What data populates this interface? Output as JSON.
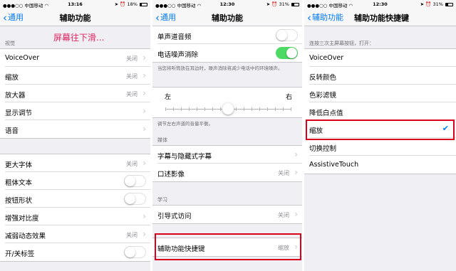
{
  "status": {
    "carrier": "中国移动",
    "time_1": "13:16",
    "battery_1": "18%",
    "battery_1_level": 0.18,
    "time_2": "12:30",
    "battery_2": "31%",
    "battery_2_level": 0.31,
    "time_3": "12:30",
    "battery_3": "31%",
    "battery_3_level": 0.31
  },
  "screen1": {
    "back_label": "通用",
    "title": "辅助功能",
    "section_vision": "视觉",
    "annotation": "屏幕往下滑...",
    "rows_a": [
      {
        "label": "VoiceOver",
        "value": "关闭"
      },
      {
        "label": "缩放",
        "value": "关闭"
      },
      {
        "label": "放大器",
        "value": "关闭"
      },
      {
        "label": "显示调节",
        "value": ""
      },
      {
        "label": "语音",
        "value": ""
      }
    ],
    "rows_b": [
      {
        "label": "更大字体",
        "value": "关闭"
      },
      {
        "label": "粗体文本",
        "value": ""
      },
      {
        "label": "按钮形状",
        "value": ""
      },
      {
        "label": "增强对比度",
        "value": ""
      },
      {
        "label": "减弱动态效果",
        "value": "关闭"
      },
      {
        "label": "开/关标签",
        "value": ""
      }
    ]
  },
  "screen2": {
    "back_label": "通用",
    "title": "辅助功能",
    "mono_audio": "单声道音频",
    "noise_cancel": "电话噪声消除",
    "noise_note": "当您将听筒放在耳边时，噪声消除将减少电话中的环境噪声。",
    "balance_left": "左",
    "balance_right": "右",
    "balance_value": 0.5,
    "balance_note": "调节左右声道的音量平衡。",
    "section_media": "媒体",
    "subtitles": "字幕与隐藏式字幕",
    "audio_desc": "口述影像",
    "audio_desc_value": "关闭",
    "section_learning": "学习",
    "guided_access": "引导式访问",
    "guided_access_value": "关闭",
    "shortcut": "辅助功能快捷键",
    "shortcut_value": "缩放"
  },
  "screen3": {
    "back_label": "辅助功能",
    "title": "辅助功能快捷键",
    "header": "连按三次主屏幕按钮，打开：",
    "options": [
      {
        "label": "VoiceOver",
        "selected": false
      },
      {
        "label": "反转颜色",
        "selected": false
      },
      {
        "label": "色彩滤镜",
        "selected": false
      },
      {
        "label": "降低白点值",
        "selected": false
      },
      {
        "label": "缩放",
        "selected": true
      },
      {
        "label": "切换控制",
        "selected": false
      },
      {
        "label": "AssistiveTouch",
        "selected": false
      }
    ]
  },
  "colors": {
    "accent": "#007aff",
    "toggle_on": "#4cd964",
    "highlight": "#d9001b",
    "annotation": "#e0245e"
  }
}
